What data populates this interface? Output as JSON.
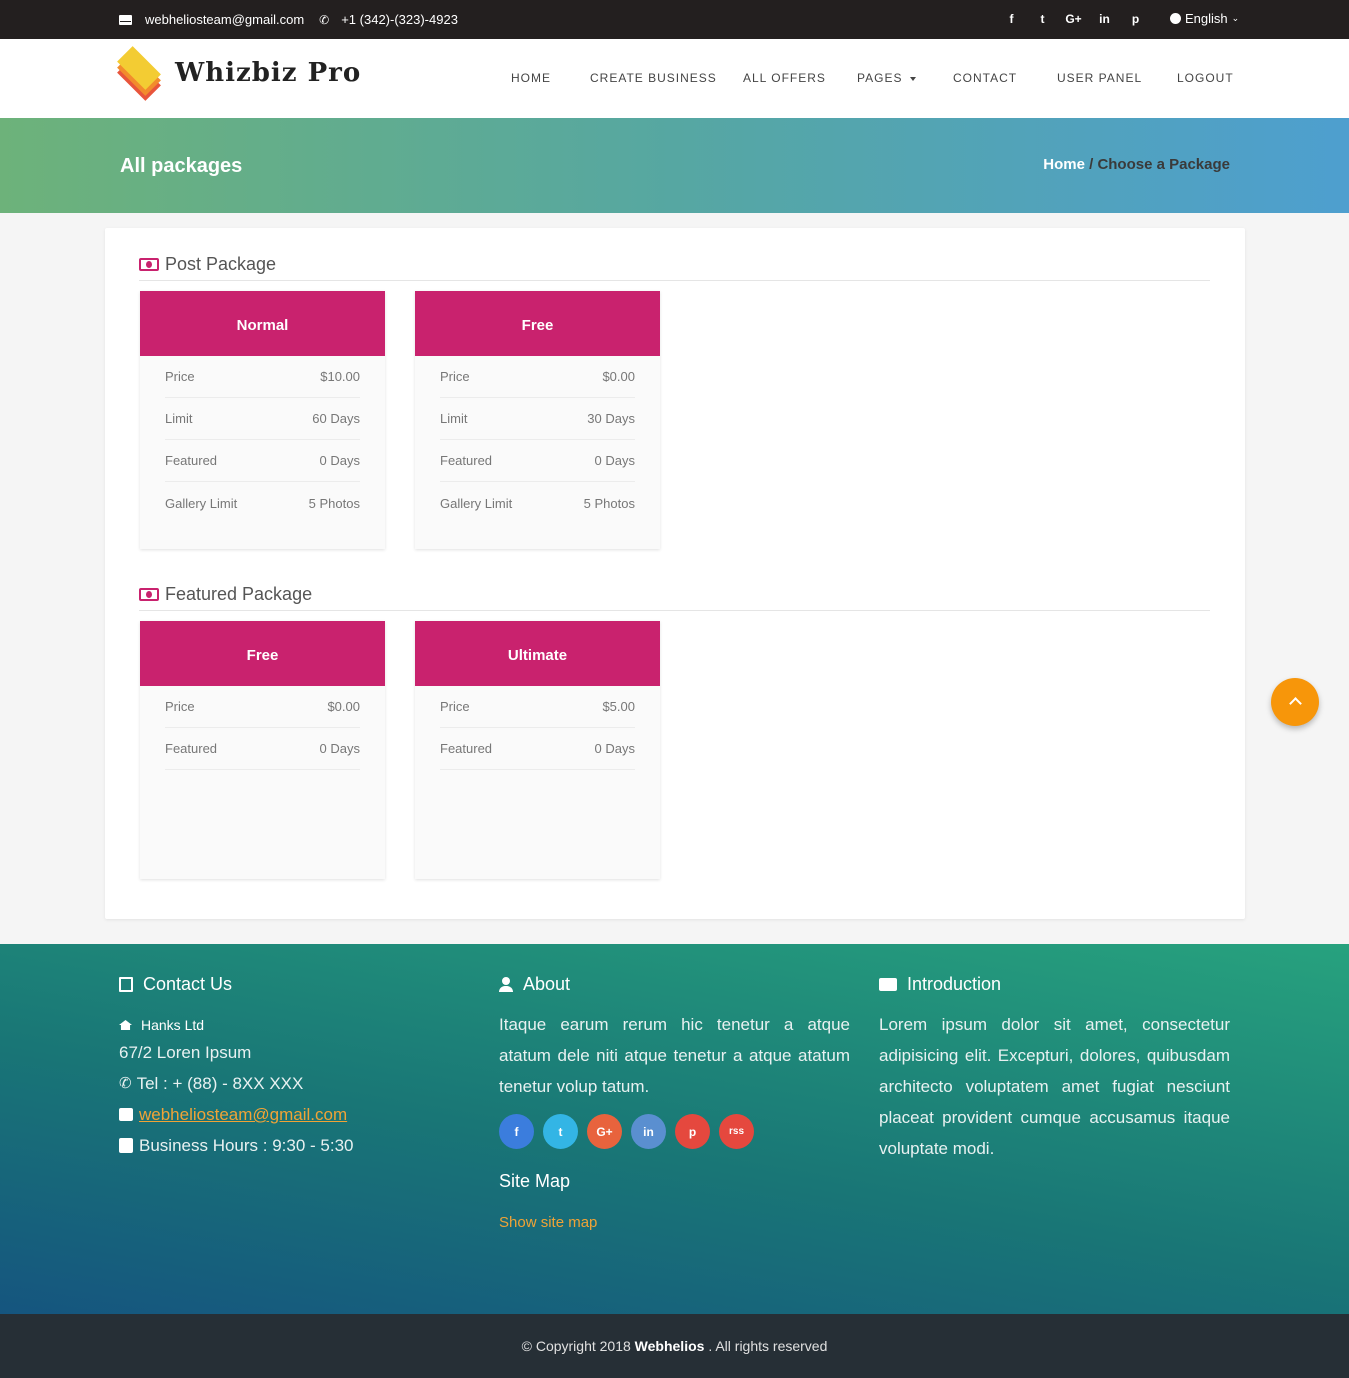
{
  "topbar": {
    "email": "webheliosteam@gmail.com",
    "phone": "+1 (342)-(323)-4923",
    "social_icons": [
      "facebook-icon",
      "twitter-icon",
      "google-plus-icon",
      "linkedin-icon",
      "pinterest-icon"
    ],
    "social_glyphs": [
      "f",
      "t",
      "G+",
      "in",
      "p"
    ],
    "language": "English"
  },
  "nav": {
    "logo_text": "Whizbiz Pro",
    "items": [
      "HOME",
      "CREATE BUSINESS",
      "ALL OFFERS",
      "PAGES",
      "CONTACT",
      "USER PANEL",
      "LOGOUT"
    ]
  },
  "banner": {
    "title": "All packages",
    "breadcrumb_home": "Home",
    "breadcrumb_sep": " / ",
    "breadcrumb_current": "Choose a Package"
  },
  "post_package": {
    "title": "Post Package",
    "packages": [
      {
        "name": "Normal",
        "rows": [
          {
            "label": "Price",
            "value": "$10.00"
          },
          {
            "label": "Limit",
            "value": "60 Days"
          },
          {
            "label": "Featured",
            "value": "0 Days"
          },
          {
            "label": "Gallery Limit",
            "value": "5 Photos"
          }
        ]
      },
      {
        "name": "Free",
        "rows": [
          {
            "label": "Price",
            "value": "$0.00"
          },
          {
            "label": "Limit",
            "value": "30 Days"
          },
          {
            "label": "Featured",
            "value": "0 Days"
          },
          {
            "label": "Gallery Limit",
            "value": "5 Photos"
          }
        ]
      }
    ]
  },
  "featured_package": {
    "title": "Featured Package",
    "packages": [
      {
        "name": "Free",
        "rows": [
          {
            "label": "Price",
            "value": "$0.00"
          },
          {
            "label": "Featured",
            "value": "0 Days"
          }
        ]
      },
      {
        "name": "Ultimate",
        "rows": [
          {
            "label": "Price",
            "value": "$5.00"
          },
          {
            "label": "Featured",
            "value": "0 Days"
          }
        ]
      }
    ]
  },
  "footer": {
    "contact": {
      "title": "Contact Us",
      "company": "Hanks Ltd",
      "address": "67/2 Loren Ipsum",
      "tel": "Tel : + (88) - 8XX XXX",
      "email": "webheliosteam@gmail.com",
      "hours": "Business Hours : 9:30 - 5:30"
    },
    "about": {
      "title": "About",
      "text": "Itaque earum rerum hic tenetur a atque atatum dele niti atque tenetur a atque atatum tenetur volup tatum.",
      "socials": [
        {
          "icon": "facebook-icon",
          "glyph": "f",
          "color": "#3b7ddd"
        },
        {
          "icon": "twitter-icon",
          "glyph": "t",
          "color": "#33b5e5"
        },
        {
          "icon": "google-plus-icon",
          "glyph": "G+",
          "color": "#e8633d"
        },
        {
          "icon": "linkedin-icon",
          "glyph": "in",
          "color": "#5a8fd0"
        },
        {
          "icon": "pinterest-icon",
          "glyph": "p",
          "color": "#e5483e"
        },
        {
          "icon": "rss-icon",
          "glyph": "rss",
          "color": "#e5483e"
        }
      ],
      "sitemap_title": "Site Map",
      "sitemap_link": "Show site map"
    },
    "intro": {
      "title": "Introduction",
      "text": "Lorem ipsum dolor sit amet, consectetur adipisicing elit. Excepturi, dolores, quibusdam architecto voluptatem amet fugiat nesciunt placeat provident cumque accusamus itaque voluptate modi."
    }
  },
  "copyright": {
    "prefix": "© Copyright 2018 ",
    "brand": "Webhelios",
    "suffix": " . All rights reserved"
  },
  "colors": {
    "accent": "#c9226e",
    "topbar": "#231f1f",
    "scroll_top": "#f7960a",
    "link": "#f0a336"
  }
}
